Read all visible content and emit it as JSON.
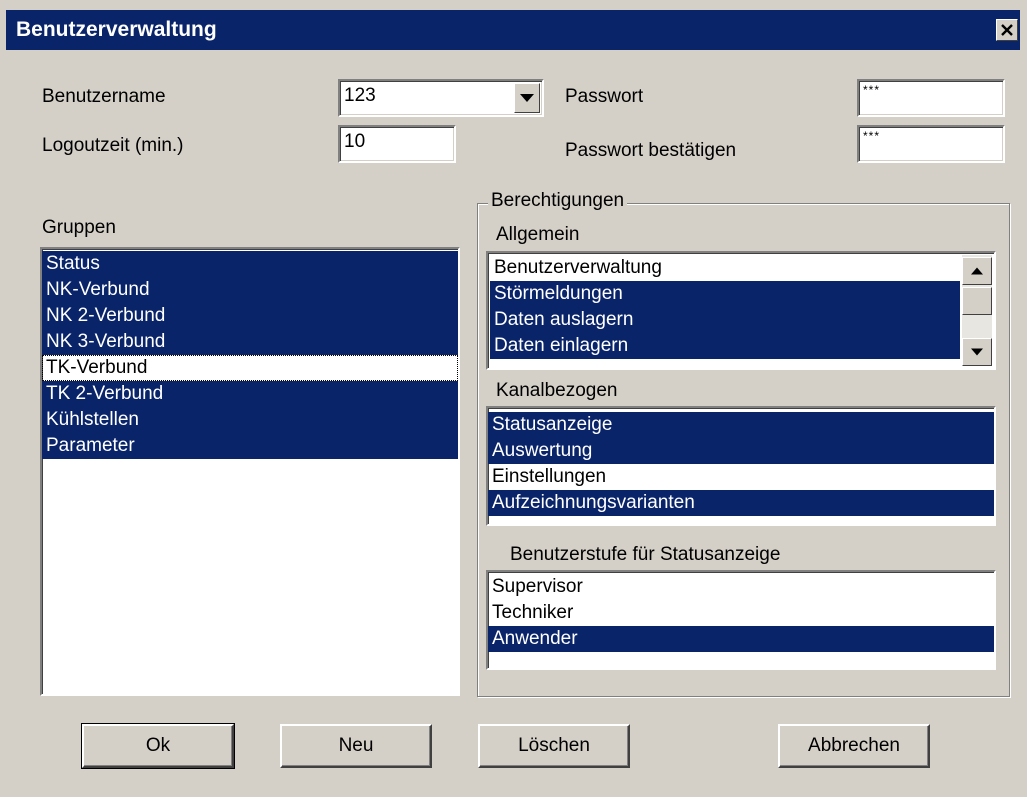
{
  "window": {
    "title": "Benutzerverwaltung"
  },
  "fields": {
    "username_label": "Benutzername",
    "username_value": "123",
    "logout_label": "Logoutzeit (min.)",
    "logout_value": "10",
    "password_label": "Passwort",
    "password_value": "***",
    "password_confirm_label": "Passwort bestätigen",
    "password_confirm_value": "***"
  },
  "groups": {
    "label": "Gruppen",
    "items": [
      {
        "label": "Status",
        "selected": true
      },
      {
        "label": "NK-Verbund",
        "selected": true
      },
      {
        "label": "NK 2-Verbund",
        "selected": true
      },
      {
        "label": "NK 3-Verbund",
        "selected": true
      },
      {
        "label": "TK-Verbund",
        "selected": false,
        "focused": true
      },
      {
        "label": "TK 2-Verbund",
        "selected": true
      },
      {
        "label": "Kühlstellen",
        "selected": true
      },
      {
        "label": "Parameter",
        "selected": true
      }
    ]
  },
  "permissions": {
    "label": "Berechtigungen",
    "general": {
      "label": "Allgemein",
      "items": [
        {
          "label": "Benutzerverwaltung",
          "selected": false
        },
        {
          "label": "Störmeldungen",
          "selected": true
        },
        {
          "label": "Daten auslagern",
          "selected": true
        },
        {
          "label": "Daten einlagern",
          "selected": true
        }
      ]
    },
    "channel": {
      "label": "Kanalbezogen",
      "items": [
        {
          "label": "Statusanzeige",
          "selected": true
        },
        {
          "label": "Auswertung",
          "selected": true
        },
        {
          "label": "Einstellungen",
          "selected": false
        },
        {
          "label": "Aufzeichnungsvarianten",
          "selected": true
        }
      ]
    },
    "userlevel": {
      "label": "Benutzerstufe für Statusanzeige",
      "items": [
        {
          "label": "Supervisor",
          "selected": false
        },
        {
          "label": "Techniker",
          "selected": false
        },
        {
          "label": "Anwender",
          "selected": true
        }
      ]
    }
  },
  "buttons": {
    "ok": "Ok",
    "new": "Neu",
    "delete": "Löschen",
    "cancel": "Abbrechen"
  },
  "colors": {
    "selection": "#0a246a",
    "face": "#d4d0c8"
  },
  "icons": {
    "close": "close-icon",
    "dropdown": "chevron-down-icon",
    "scroll_up": "arrow-up-icon",
    "scroll_down": "arrow-down-icon"
  }
}
